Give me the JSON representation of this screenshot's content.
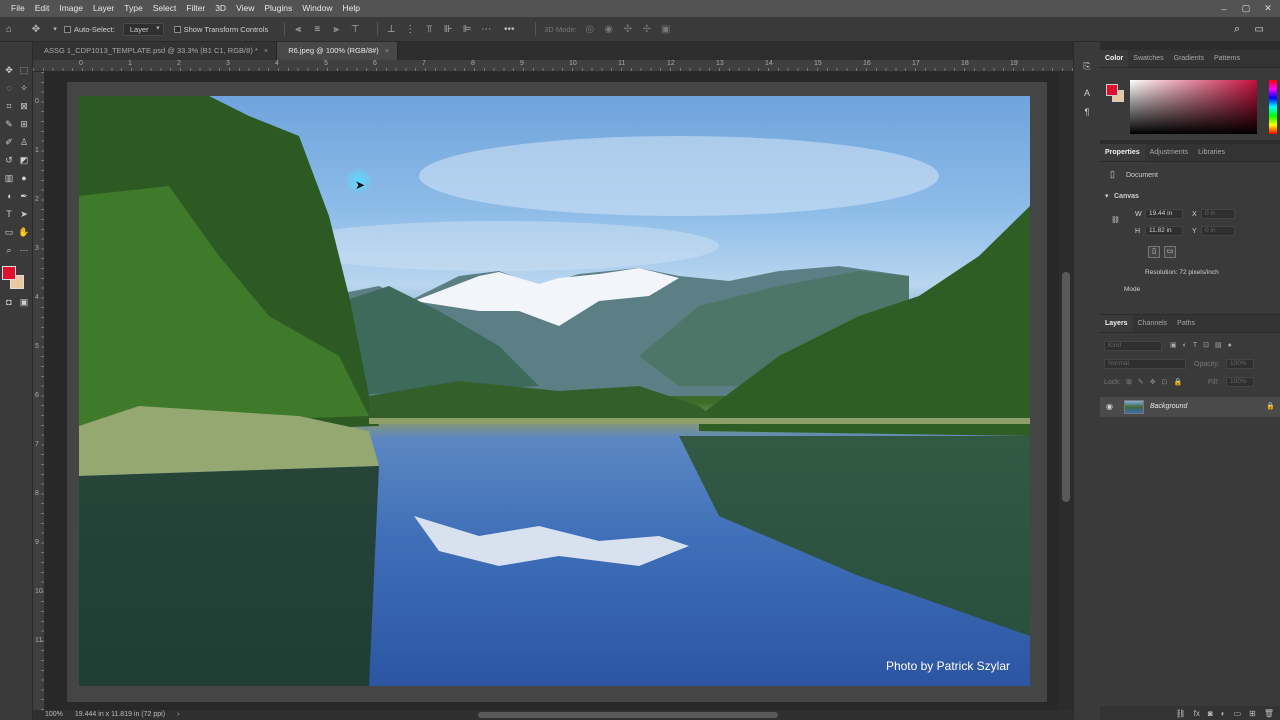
{
  "menu": [
    "File",
    "Edit",
    "Image",
    "Layer",
    "Type",
    "Select",
    "Filter",
    "3D",
    "View",
    "Plugins",
    "Window",
    "Help"
  ],
  "window_controls": [
    "–",
    "▢",
    "✕"
  ],
  "options": {
    "auto_select_label": "Auto-Select:",
    "auto_select_target": "Layer",
    "transform_label": "Show Transform Controls",
    "mode_3d_label": "3D Mode:",
    "more_label": "•••"
  },
  "tabs": [
    {
      "label": "ASSG 1_CDP1013_TEMPLATE.psd @ 33.3% (B1 C1, RGB/8) *",
      "close": "×",
      "active": false
    },
    {
      "label": "R6.jpeg @ 100% (RGB/8#)",
      "close": "×",
      "active": true
    }
  ],
  "ruler": {
    "top": [
      "0",
      "1",
      "2",
      "3",
      "4",
      "5",
      "6",
      "7",
      "8",
      "9",
      "10",
      "11",
      "12",
      "13",
      "14",
      "15",
      "16",
      "17",
      "18",
      "19"
    ],
    "left": [
      "0",
      "1",
      "2",
      "3",
      "4",
      "5",
      "6",
      "7",
      "8",
      "9",
      "10",
      "11"
    ]
  },
  "photo_credit": "Photo by Patrick Szylar",
  "status": {
    "zoom": "100%",
    "doc_info": "19.444 in x 11.819 in (72 ppi)",
    "arrow": "›"
  },
  "color_panel": {
    "tabs": [
      "Color",
      "Swatches",
      "Gradients",
      "Patterns"
    ],
    "foreground": "#e0102c",
    "background": "#e8c9a2"
  },
  "properties_panel": {
    "tabs": [
      "Properties",
      "Adjustments",
      "Libraries"
    ],
    "document_label": "Document",
    "canvas_label": "Canvas",
    "w_label": "W",
    "w_value": "19.44 in",
    "h_label": "H",
    "h_value": "11.82 in",
    "x_label": "X",
    "x_value": "0 in",
    "y_label": "Y",
    "y_value": "0 in",
    "resolution": "Resolution: 72 pixels/inch",
    "mode_label": "Mode"
  },
  "layers_panel": {
    "tabs": [
      "Layers",
      "Channels",
      "Paths"
    ],
    "kind_placeholder": "Kind",
    "blend_mode": "Normal",
    "opacity_label": "Opacity:",
    "opacity_value": "100%",
    "lock_label": "Lock:",
    "fill_label": "Fill:",
    "fill_value": "100%",
    "layers": [
      {
        "name": "Background",
        "visible": true,
        "locked": true
      }
    ],
    "footer_icons": [
      "link-icon",
      "fx-icon",
      "mask-icon",
      "adjustment-icon",
      "group-icon",
      "new-layer-icon",
      "trash-icon"
    ]
  }
}
